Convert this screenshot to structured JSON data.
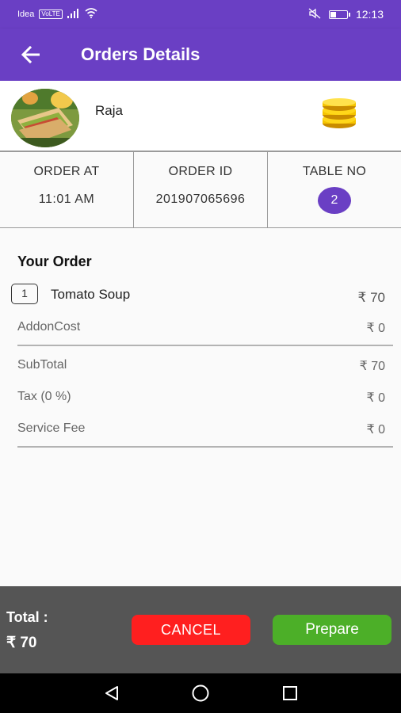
{
  "status_bar": {
    "carrier": "Idea",
    "network_badge": "VoLTE",
    "time": "12:13",
    "battery_level": 0.3,
    "icons": [
      "signal-icon",
      "wifi-icon",
      "mute-icon",
      "battery-icon"
    ]
  },
  "toolbar": {
    "title": "Orders Details",
    "back_icon": "arrow-left-icon"
  },
  "customer": {
    "name": "Raja",
    "avatar_icon": "food-avatar",
    "reward_icon": "coins-icon"
  },
  "order_info": {
    "order_at_label": "ORDER AT",
    "order_at_value": "11:01 AM",
    "order_id_label": "ORDER ID",
    "order_id_value": "201907065696",
    "table_no_label": "TABLE NO",
    "table_no_value": "2"
  },
  "order": {
    "heading": "Your Order",
    "items": [
      {
        "qty": "1",
        "name": "Tomato Soup",
        "price": "₹ 70"
      }
    ],
    "addon_label": "AddonCost",
    "addon_value": "₹ 0",
    "subtotal_label": "SubTotal",
    "subtotal_value": "₹ 70",
    "tax_label": "Tax (0 %)",
    "tax_value": "₹ 0",
    "service_fee_label": "Service Fee",
    "service_fee_value": "₹ 0"
  },
  "footer": {
    "total_label": "Total :",
    "total_value": "₹ 70",
    "cancel_label": "CANCEL",
    "prepare_label": "Prepare"
  },
  "nav": {
    "icons": [
      "back-triangle-icon",
      "home-circle-icon",
      "recents-square-icon"
    ]
  },
  "colors": {
    "primary": "#6a3fc4",
    "cancel": "#ff1f1f",
    "prepare": "#4caf28",
    "footer_bg": "#555555"
  }
}
